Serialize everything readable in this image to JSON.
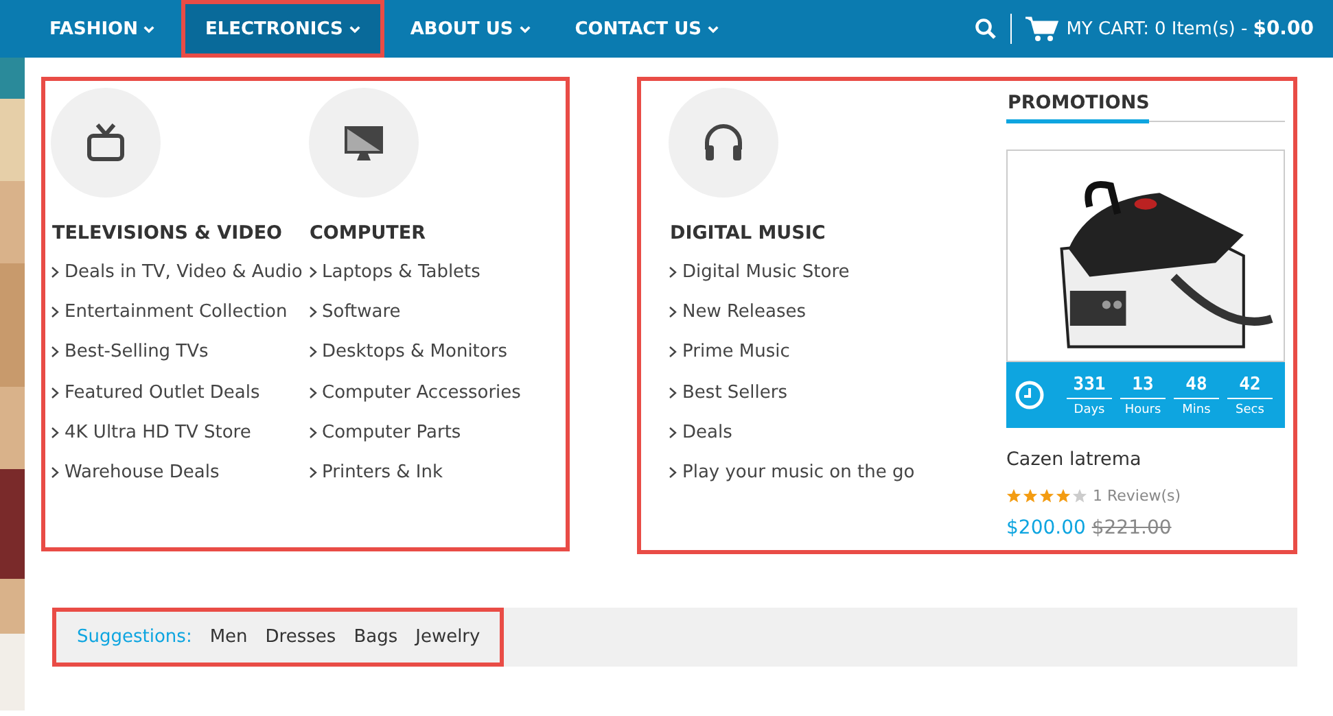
{
  "nav": {
    "items": [
      {
        "label": "FASHION",
        "selected": false
      },
      {
        "label": "ELECTRONICS",
        "selected": true
      },
      {
        "label": "ABOUT US",
        "selected": false
      },
      {
        "label": "CONTACT US",
        "selected": false
      }
    ],
    "cart": {
      "label": "MY CART:",
      "count": "0 Item(s) -",
      "total": "$0.00"
    }
  },
  "categories": [
    {
      "kind": "tv",
      "title": "TELEVISIONS & VIDEO",
      "links": [
        "Deals in TV, Video & Audio",
        "Entertainment Collection",
        "Best-Selling TVs",
        "Featured Outlet Deals",
        "4K Ultra HD TV Store",
        "Warehouse Deals"
      ]
    },
    {
      "kind": "monitor",
      "title": "COMPUTER",
      "links": [
        "Laptops & Tablets",
        "Software",
        "Desktops & Monitors",
        "Computer Accessories",
        "Computer Parts",
        "Printers & Ink"
      ]
    },
    {
      "kind": "headphones",
      "title": "DIGITAL MUSIC",
      "links": [
        "Digital Music Store",
        "New Releases",
        "Prime Music",
        "Best Sellers",
        "Deals",
        "Play your music on the go"
      ]
    }
  ],
  "promotions": {
    "title": "PROMOTIONS",
    "product": {
      "countdown": [
        {
          "value": "331",
          "unit": "Days"
        },
        {
          "value": "13",
          "unit": "Hours"
        },
        {
          "value": "48",
          "unit": "Mins"
        },
        {
          "value": "42",
          "unit": "Secs"
        }
      ],
      "name": "Cazen latrema",
      "stars": 4,
      "reviews": "1 Review(s)",
      "price": "$200.00",
      "old_price": "$221.00"
    }
  },
  "suggestions": {
    "label": "Suggestions:",
    "tags": [
      "Men",
      "Dresses",
      "Bags",
      "Jewelry"
    ]
  }
}
